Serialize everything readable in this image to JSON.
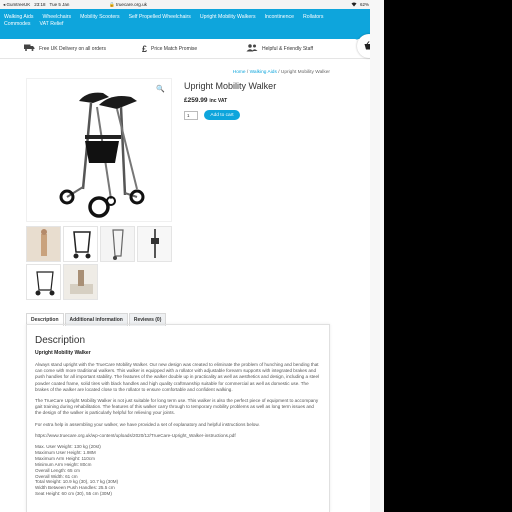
{
  "status_bar": {
    "carrier": "◂ GumtreeUK",
    "time": "23:18",
    "date": "Tue 5 Jan",
    "url": "truecare.org.uk",
    "battery": "62%"
  },
  "nav": {
    "row1": [
      "Walking Aids",
      "Wheelchairs",
      "Mobility Scooters",
      "Self Propelled Wheelchairs",
      "Upright Mobility Walkers",
      "Incontinence",
      "Rollators"
    ],
    "row2": [
      "Commodes",
      "VAT Relief"
    ]
  },
  "cart": {
    "count": "0",
    "icon": "basket-icon"
  },
  "benefits": [
    {
      "icon": "truck-icon",
      "text": "Free UK Delivery on all orders"
    },
    {
      "icon": "pound-icon",
      "text": "Price Match Promise"
    },
    {
      "icon": "users-icon",
      "text": "Helpful & Friendly Staff"
    }
  ],
  "breadcrumb": {
    "home": "Home",
    "sep1": " / ",
    "category": "Walking Aids",
    "sep2": " / ",
    "current": "Upright Mobility Walker"
  },
  "product": {
    "title": "Upright Mobility Walker",
    "price": "£259.99",
    "price_suffix": "inc VAT",
    "qty": "1",
    "add_to_cart": "Add to cart"
  },
  "tabs": [
    "Description",
    "Additional information",
    "Reviews (0)"
  ],
  "description": {
    "heading": "Description",
    "subheading": "Upright Mobility Walker",
    "p1": "Always stand upright with the TrueCare Mobility Walker. Our new design was created to eliminate the problem of hunching and bending that can come with more traditional walkers. This walker is equipped with a rollator with adjustable forearm supports with integrated brakes and push handles for all important stability. The features of the walker double up in practicality as well as aesthetics and design, including a steel powder coated frame, solid tires with black handles and high quality craftmanship suitable for commercial as well as domestic use. The brakes of the walker are located close to the rollator to ensure comfortable and confident walking.",
    "p2": "The TrueCare Upright Mobility Walker is not just suitable for long term use. This walker is also the perfect piece of equipment to accompany gait training during rehabilitation. The features of this walker carry through to temporary mobility problems as well as long term issues and the design of the walker is particularly helpful for relieving your joints.",
    "p3": "For extra help in assembling your walker, we have provided a set of explanatory and helpful instructions below.",
    "link": "https://www.truecare.org.uk/wp-content/uploads/2020/12/TrueCare-Upright_Walker-instructions.pdf",
    "specs": [
      "Max. User Weight: 130 kg (20st)",
      "Maximum User Height: 1.98M",
      "Maximum Arm Height: 110cm",
      "Minimum Arm Height: 80cm",
      "Overall Length: 65 cm",
      "Overall Width: 61 cm",
      "Total Weight: 10.9 kg (30), 10.7 kg (30M)",
      "Width Between Push Handles: 25.5 cm",
      "Seat Height: 60 cm (30), 55 cm (30M)"
    ]
  }
}
